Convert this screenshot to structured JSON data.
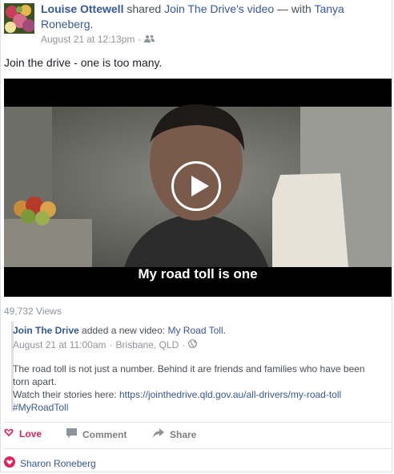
{
  "post": {
    "author": "Louise Ottewell",
    "verb": "shared",
    "shared_page": "Join The Drive's",
    "shared_object": "video",
    "with_word": "— with",
    "with_person": "Tanya Roneberg",
    "period": ".",
    "timestamp": "August 21 at 12:13pm",
    "audience_icon": "friends-icon",
    "message": "Join the drive - one is too many."
  },
  "video": {
    "caption": "My road toll is one",
    "views": "49,732 Views"
  },
  "shared_post": {
    "page": "Join The Drive",
    "action": "added a new video:",
    "video_title": "My Road Toll",
    "timestamp": "August 21 at 11:00am",
    "location": "Brisbane, QLD",
    "audience_icon": "globe-icon",
    "body_line1": "The road toll is not just a number. Behind it are friends and families who have been torn apart.",
    "body_line2_prefix": "Watch their stories here:",
    "url": "https://jointhedrive.qld.gov.au/all-drivers/my-road-toll",
    "hashtag": "#MyRoadToll"
  },
  "actions": {
    "love": "Love",
    "comment": "Comment",
    "share": "Share"
  },
  "reactions": {
    "name": "Sharon Roneberg"
  },
  "colors": {
    "link": "#365899",
    "love": "#e0245e"
  }
}
